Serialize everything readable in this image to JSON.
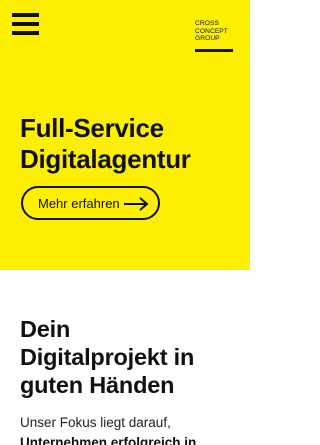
{
  "header": {
    "menu_icon": "hamburger-menu-icon",
    "logo": {
      "line1": "CROSS",
      "line2": "CONCEPT",
      "line3": "GROUP"
    }
  },
  "hero": {
    "background_color": "#fcef00",
    "title_line1": "Full-Service",
    "title_line2": "Digitalagentur",
    "cta_label": "Mehr erfahren",
    "cta_icon": "arrow-right-icon"
  },
  "section": {
    "title_line1": "Dein",
    "title_line2": "Digitalprojekt in",
    "title_line3": "guten Händen",
    "intro_line1": "Unser Fokus liegt darauf,",
    "intro_line2": "Unternehmen erfolgreich in"
  }
}
